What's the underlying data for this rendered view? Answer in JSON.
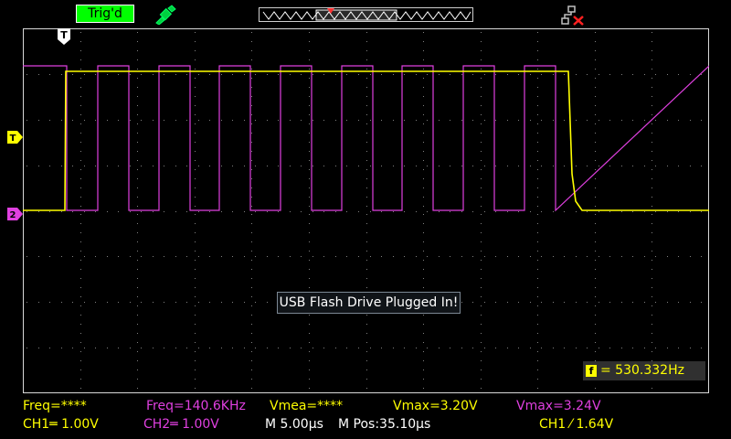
{
  "header": {
    "trigger_status": "Trig'd",
    "trigger_status_color": "#00ff00"
  },
  "icons": {
    "usb": "usb-plug-icon",
    "network": "network-disconnected-icon"
  },
  "markers": {
    "trigger_position": "T",
    "trigger_level": "T",
    "ch2_reference": "2"
  },
  "popup": {
    "message": "USB Flash Drive Plugged In!"
  },
  "frequency_counter": {
    "icon_label": "f",
    "value": "= 530.332Hz"
  },
  "measurements": {
    "ch1_freq": "Freq=****",
    "ch2_freq": "Freq=140.6KHz",
    "ch1_vmean": "Vmea=****",
    "ch1_vmax": "Vmax=3.20V",
    "ch2_vmax": "Vmax=3.24V"
  },
  "settings": {
    "ch1_scale": "CH1═ 1.00V",
    "ch2_scale": "CH2═ 1.00V",
    "timebase": "M 5.00µs",
    "horizontal_position": "M Pos:35.10µs",
    "trigger": "CH1 ⁄ 1.64V"
  },
  "colors": {
    "ch1": "#ffff00",
    "ch2": "#e040e0",
    "grid": "#808080"
  }
}
